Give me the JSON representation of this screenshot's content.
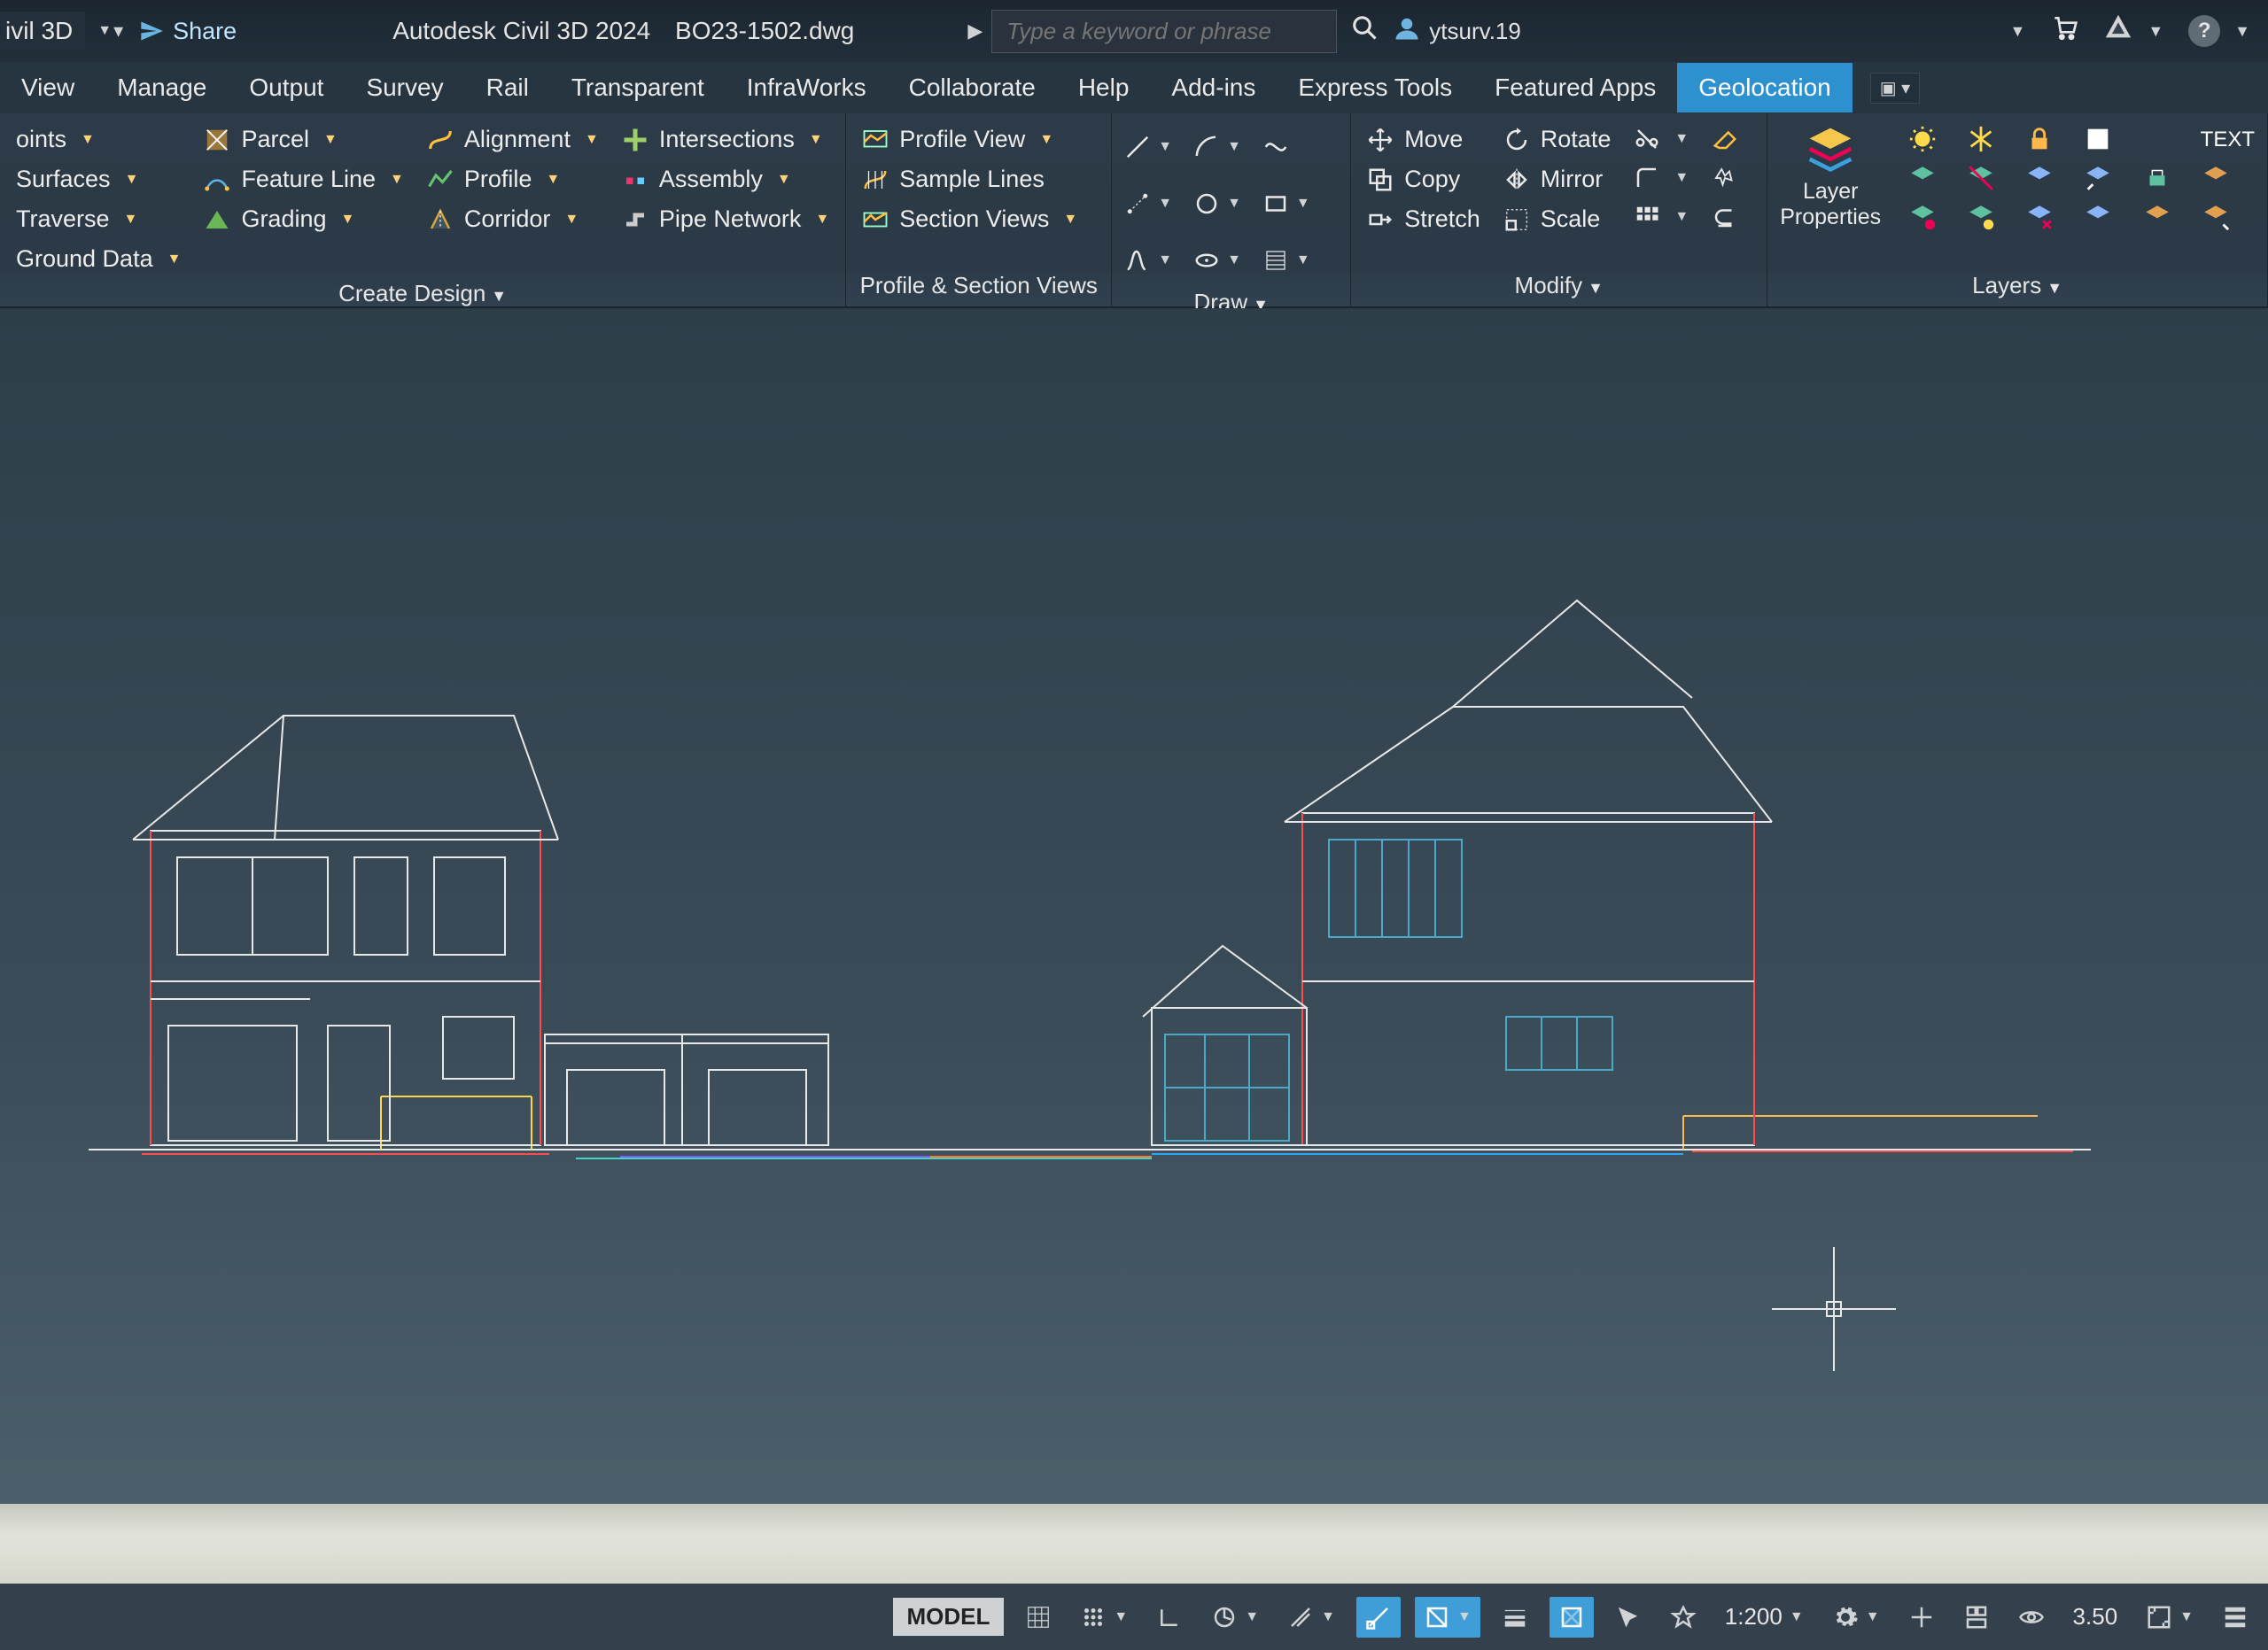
{
  "titlebar": {
    "workspace": "ivil 3D",
    "share": "Share",
    "app": "Autodesk Civil 3D 2024",
    "filename": "BO23-1502.dwg",
    "search_placeholder": "Type a keyword or phrase",
    "username": "ytsurv.19"
  },
  "tabs": [
    "View",
    "Manage",
    "Output",
    "Survey",
    "Rail",
    "Transparent",
    "InfraWorks",
    "Collaborate",
    "Help",
    "Add-ins",
    "Express Tools",
    "Featured Apps",
    "Geolocation"
  ],
  "active_tab": "Geolocation",
  "ribbon": {
    "panel1": {
      "col1": [
        "oints",
        "Surfaces",
        "Traverse",
        "Ground Data"
      ],
      "col2": [
        "Parcel",
        "Feature Line",
        "Grading"
      ],
      "col3": [
        "Alignment",
        "Profile",
        "Corridor"
      ],
      "col4": [
        "Intersections",
        "Assembly",
        "Pipe Network"
      ],
      "title": "Create Design"
    },
    "panel2": {
      "items": [
        "Profile View",
        "Sample Lines",
        "Section Views"
      ],
      "title": "Profile & Section Views"
    },
    "panel3": {
      "title": "Draw"
    },
    "panel4": {
      "row1": [
        "Move",
        "Rotate"
      ],
      "row2": [
        "Copy",
        "Mirror"
      ],
      "row3": [
        "Stretch",
        "Scale"
      ],
      "title": "Modify"
    },
    "panel5": {
      "label": "Layer\nProperties",
      "text_label": "TEXT",
      "title": "Layers"
    }
  },
  "statusbar": {
    "model": "MODEL",
    "scale": "1:200",
    "thickness": "3.50"
  }
}
